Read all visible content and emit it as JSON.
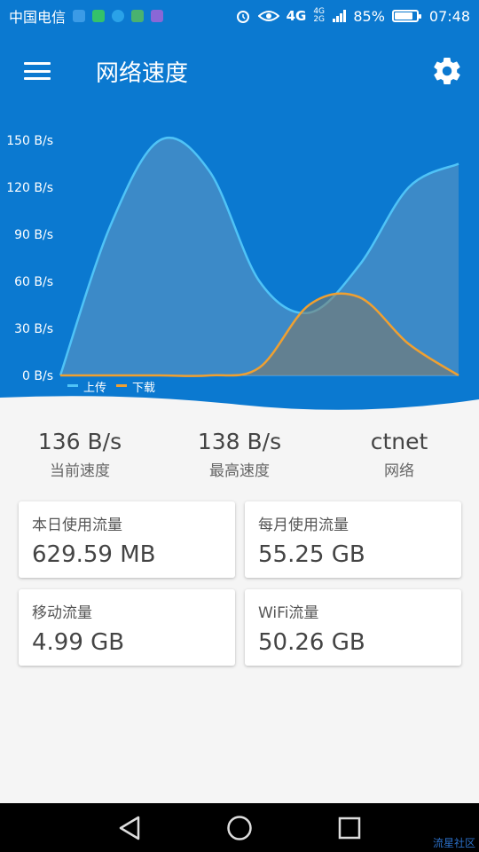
{
  "status_bar": {
    "carrier": "中国电信",
    "network": "4G",
    "network_small": "4G 2G",
    "battery": "85%",
    "battery_level": 0.85,
    "time": "07:48",
    "icons": [
      "alarm-icon",
      "eye-icon",
      "signal-icon",
      "battery-icon"
    ]
  },
  "app_bar": {
    "title": "网络速度",
    "menu_icon": "hamburger-menu-icon",
    "settings_icon": "gear-icon"
  },
  "chart_data": {
    "type": "area",
    "y_ticks": [
      "0 B/s",
      "30 B/s",
      "60 B/s",
      "90 B/s",
      "120 B/s",
      "150 B/s"
    ],
    "ylim": [
      0,
      150
    ],
    "x": [
      0,
      1,
      2,
      3,
      4,
      5,
      6,
      7,
      8
    ],
    "series": [
      {
        "name": "上传",
        "color": "#4fc3f7",
        "values": [
          0,
          95,
          150,
          130,
          60,
          40,
          70,
          120,
          135
        ]
      },
      {
        "name": "下载",
        "color": "#f0a030",
        "values": [
          0,
          0,
          0,
          0,
          5,
          45,
          50,
          20,
          0
        ]
      }
    ],
    "legend": "bottom-left"
  },
  "stats": [
    {
      "value": "136 B/s",
      "label": "当前速度"
    },
    {
      "value": "138 B/s",
      "label": "最高速度"
    },
    {
      "value": "ctnet",
      "label": "网络"
    }
  ],
  "cards": [
    {
      "title": "本日使用流量",
      "value": "629.59 MB"
    },
    {
      "title": "每月使用流量",
      "value": "55.25 GB"
    },
    {
      "title": "移动流量",
      "value": "4.99 GB"
    },
    {
      "title": "WiFi流量",
      "value": "50.26 GB"
    }
  ],
  "nav": {
    "back": "back-triangle-icon",
    "home": "home-circle-icon",
    "recents": "recents-square-icon"
  },
  "watermark": "流星社区"
}
